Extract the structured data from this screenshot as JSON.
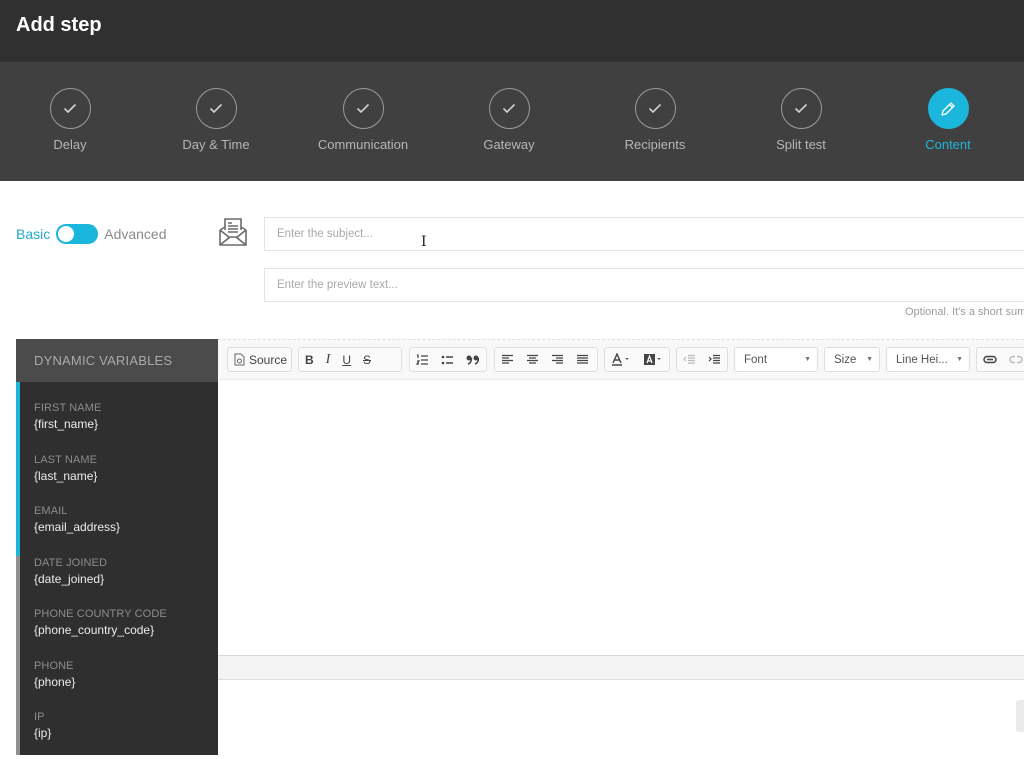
{
  "header": {
    "title": "Add step"
  },
  "stepper": {
    "steps": [
      {
        "label": "Delay",
        "state": "done",
        "icon": "check-icon"
      },
      {
        "label": "Day & Time",
        "state": "done",
        "icon": "check-icon"
      },
      {
        "label": "Communication",
        "state": "done",
        "icon": "check-icon"
      },
      {
        "label": "Gateway",
        "state": "done",
        "icon": "check-icon"
      },
      {
        "label": "Recipients",
        "state": "done",
        "icon": "check-icon"
      },
      {
        "label": "Split test",
        "state": "done",
        "icon": "check-icon"
      },
      {
        "label": "Content",
        "state": "active",
        "icon": "pencil-icon"
      }
    ],
    "accent_color": "#1ab6dc"
  },
  "mode": {
    "basic_label": "Basic",
    "advanced_label": "Advanced",
    "selected": "Basic"
  },
  "subject": {
    "placeholder": "Enter the subject...",
    "value": ""
  },
  "preview": {
    "placeholder": "Enter the preview text...",
    "value": "",
    "hint": "Optional. It's a short sum"
  },
  "variables": {
    "title": "DYNAMIC VARIABLES",
    "items": [
      {
        "label": "FIRST NAME",
        "token": "{first_name}"
      },
      {
        "label": "LAST NAME",
        "token": "{last_name}"
      },
      {
        "label": "EMAIL",
        "token": "{email_address}"
      },
      {
        "label": "DATE JOINED",
        "token": "{date_joined}"
      },
      {
        "label": "PHONE COUNTRY CODE",
        "token": "{phone_country_code}"
      },
      {
        "label": "PHONE",
        "token": "{phone}"
      },
      {
        "label": "IP",
        "token": "{ip}"
      }
    ]
  },
  "toolbar": {
    "source_label": "Source",
    "bold": "B",
    "italic": "I",
    "underline": "U",
    "strike": "S",
    "font_label": "Font",
    "size_label": "Size",
    "line_height_label": "Line Hei..."
  }
}
